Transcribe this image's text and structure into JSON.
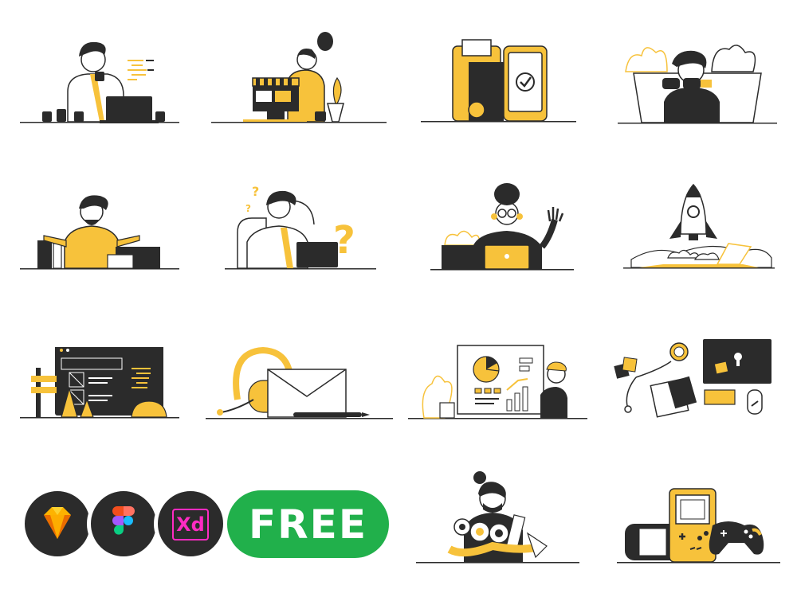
{
  "page": {
    "background": "#ffffff",
    "accent": "#f7c23b",
    "ink": "#2b2b2b"
  },
  "illustrations": [
    {
      "name": "developer-coffee",
      "icon": "developer-laptop-icon"
    },
    {
      "name": "online-shop",
      "icon": "shop-stall-icon"
    },
    {
      "name": "mobile-payment",
      "icon": "wallet-phone-icon"
    },
    {
      "name": "search-binoculars",
      "icon": "binoculars-icon"
    },
    {
      "name": "confused-files",
      "icon": "shrug-files-icon"
    },
    {
      "name": "question-laptop",
      "icon": "question-mark-icon"
    },
    {
      "name": "video-call-wave",
      "icon": "waving-laptop-icon"
    },
    {
      "name": "rocket-launch",
      "icon": "rocket-icon"
    },
    {
      "name": "under-construction",
      "icon": "construction-cone-icon"
    },
    {
      "name": "support-mail",
      "icon": "headset-envelope-icon"
    },
    {
      "name": "business-report",
      "icon": "pie-chart-icon"
    },
    {
      "name": "workspace-topview",
      "icon": "workspace-icon"
    },
    {
      "name": "carrying-items",
      "icon": "carrying-person-icon"
    },
    {
      "name": "game-consoles",
      "icon": "gamepad-icon"
    }
  ],
  "tools": {
    "sketch": {
      "icon": "sketch-diamond-icon"
    },
    "figma": {
      "icon": "figma-icon"
    },
    "xd": {
      "icon": "adobe-xd-icon",
      "label": "Xd"
    },
    "free_label": "FREE",
    "free_color": "#21b04b"
  }
}
